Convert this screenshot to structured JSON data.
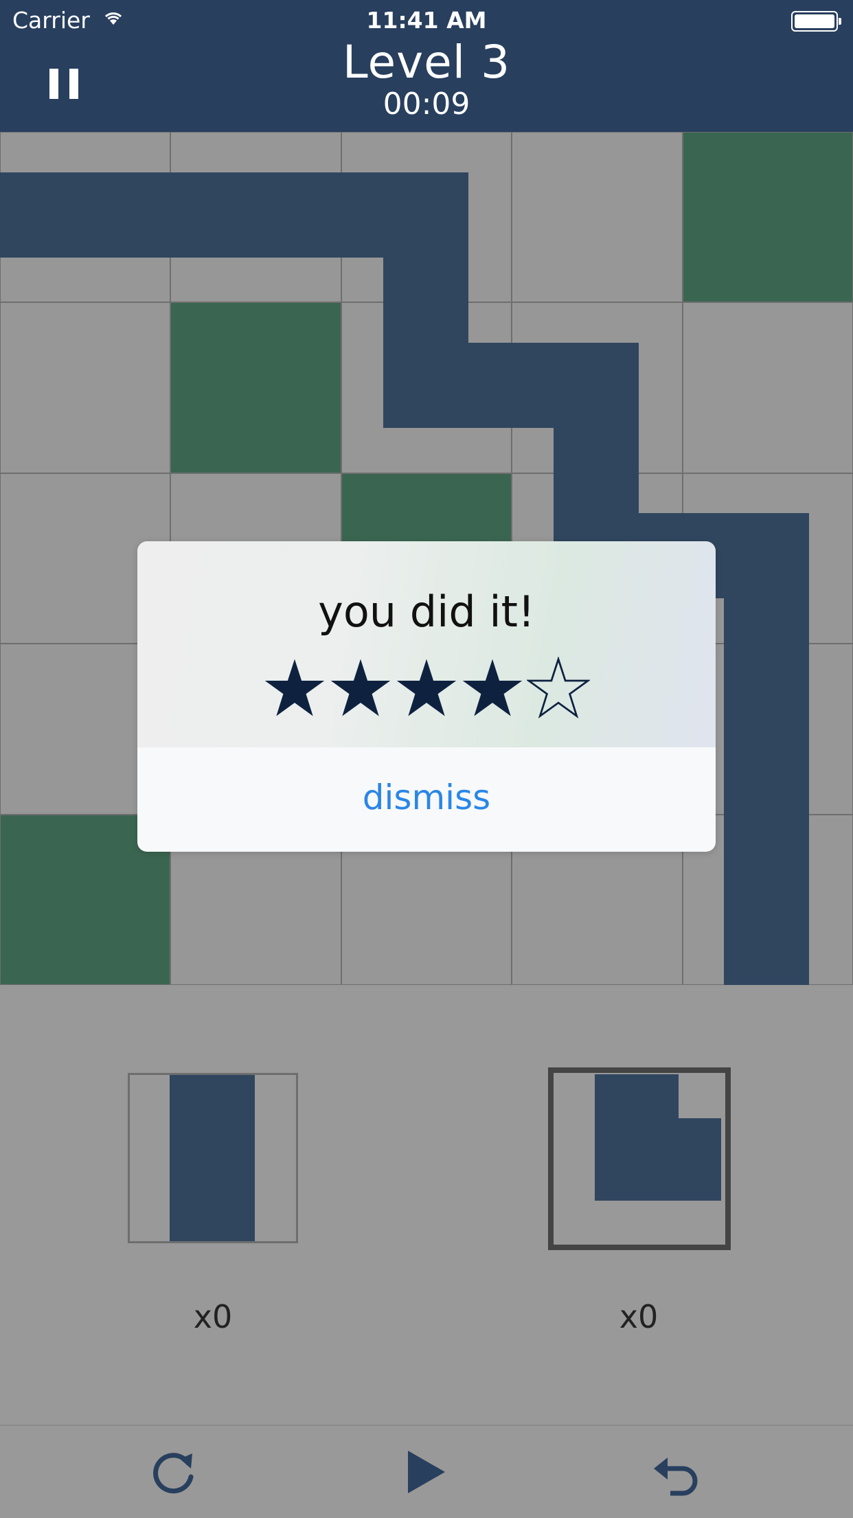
{
  "status_bar": {
    "carrier": "Carrier",
    "time": "11:41 AM"
  },
  "header": {
    "title": "Level 3",
    "timer": "00:09"
  },
  "board": {
    "rows": 5,
    "cols": 5,
    "target_cells": [
      [
        0,
        4
      ],
      [
        1,
        1
      ],
      [
        2,
        2
      ],
      [
        4,
        0
      ]
    ]
  },
  "tray": {
    "pieces": [
      {
        "name": "straight-vertical-piece",
        "count": "x0",
        "selected": false
      },
      {
        "name": "corner-piece",
        "count": "x0",
        "selected": true
      }
    ]
  },
  "dialog": {
    "message": "you did it!",
    "stars_earned": 4,
    "stars_total": 5,
    "dismiss_label": "dismiss"
  },
  "toolbar": {
    "icons": [
      "restart-icon",
      "play-icon",
      "undo-icon"
    ]
  },
  "colors": {
    "header_bg": "#283f5e",
    "pipe": "#30465f",
    "target": "#3a6651",
    "cell": "#979797",
    "star": "#0e2240",
    "dismiss_link": "#2a86e6"
  }
}
